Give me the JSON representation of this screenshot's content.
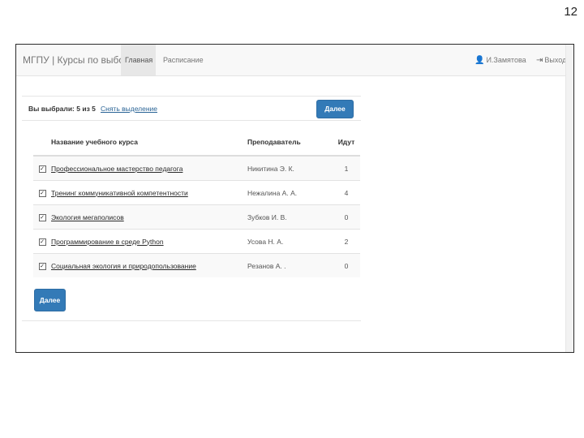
{
  "slide_number": "12",
  "navbar": {
    "brand": "МГПУ | Курсы по выбору",
    "tabs": [
      {
        "label": "Главная",
        "active": true
      },
      {
        "label": "Расписание",
        "active": false
      }
    ],
    "user": {
      "icon": "user-icon",
      "name": "И.Замятова"
    },
    "logout": {
      "icon": "logout-icon",
      "label": "Выход"
    }
  },
  "selection": {
    "prefix": "Вы выбрали:",
    "count": "5 из 5",
    "clear_link": "Снять выделение",
    "next_button": "Далее"
  },
  "table": {
    "headers": [
      "Название учебного курса",
      "Преподаватель",
      "Идут"
    ],
    "rows": [
      {
        "checked": true,
        "course": "Профессиональное мастерство педагога",
        "teacher": "Никитина Э. К.",
        "count": "1"
      },
      {
        "checked": true,
        "course": "Тренинг коммуникативной компетентности",
        "teacher": "Нежалина А. А.",
        "count": "4"
      },
      {
        "checked": true,
        "course": "Экология мегаполисов",
        "teacher": "Зубков И. В.",
        "count": "0"
      },
      {
        "checked": true,
        "course": "Программирование в среде Python",
        "teacher": "Усова Н. А.",
        "count": "2"
      },
      {
        "checked": true,
        "course": "Социальная экология и природопользование",
        "teacher": "Резанов А. .",
        "count": "0"
      }
    ]
  },
  "bottom_button": "Далее",
  "colors": {
    "primary": "#337ab7",
    "navbar_bg": "#f8f8f8",
    "active_tab_bg": "#e7e7e7"
  }
}
